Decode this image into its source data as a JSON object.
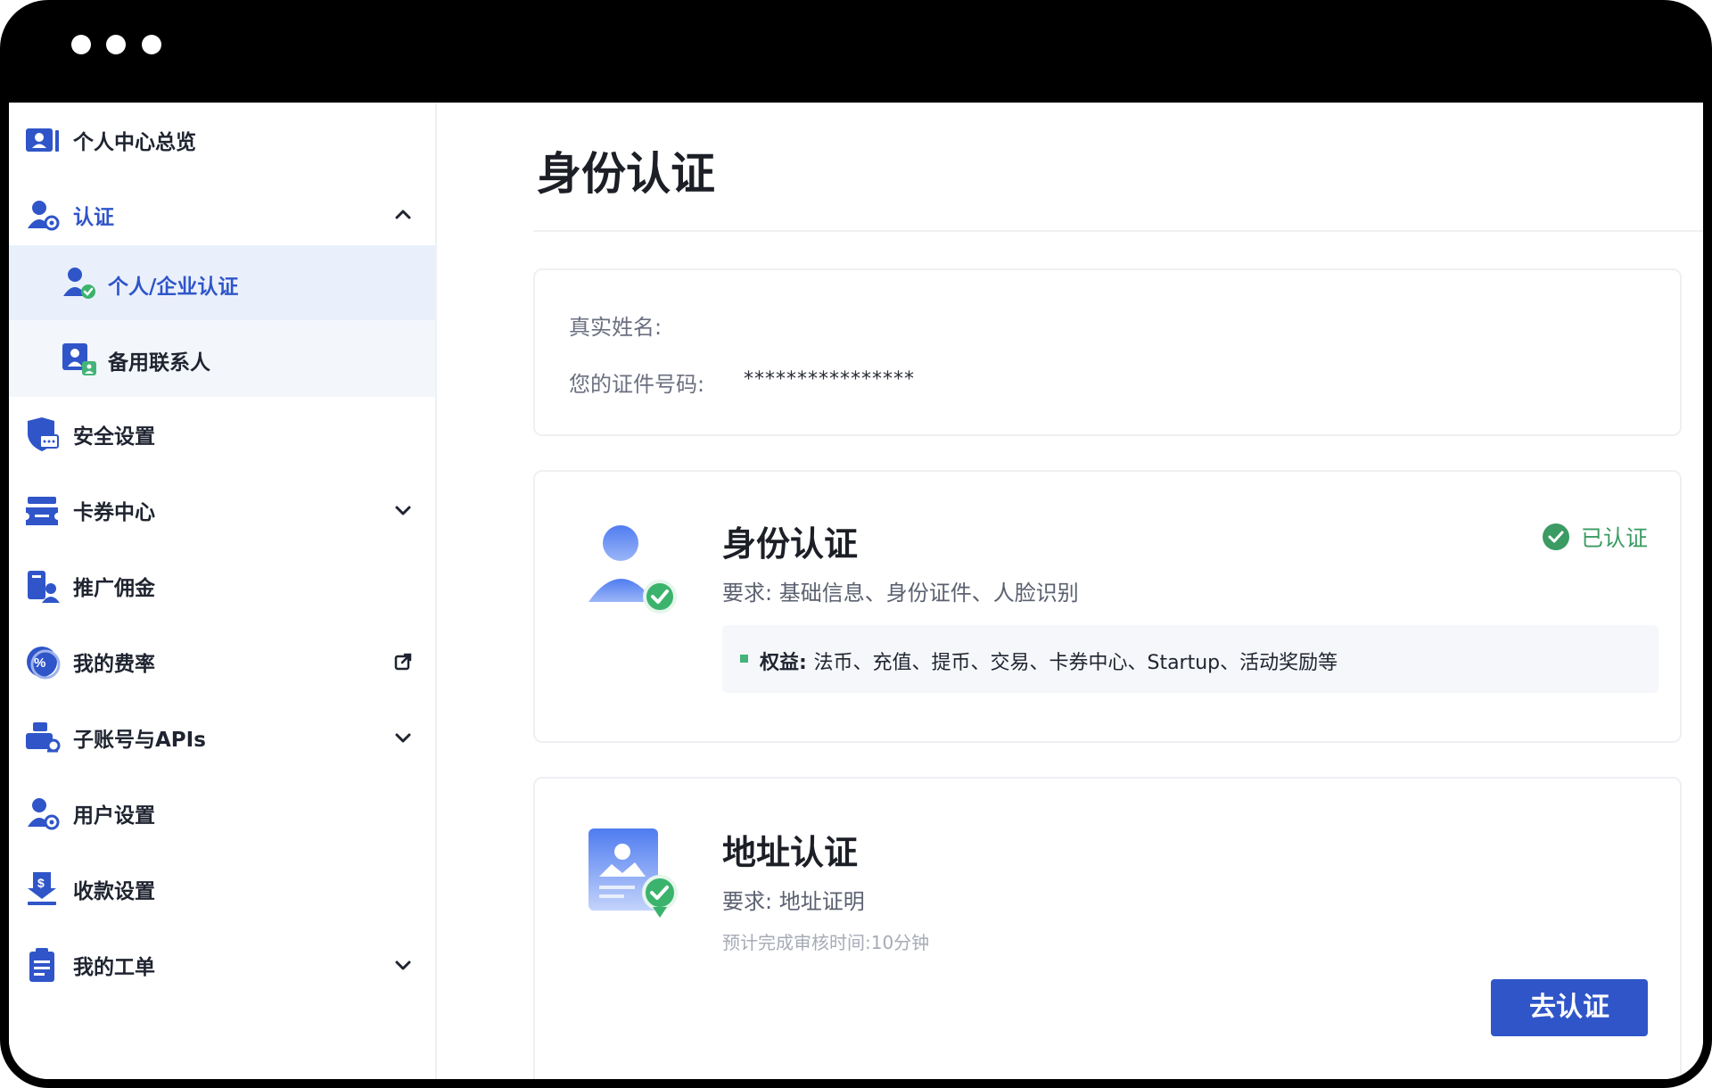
{
  "window": {
    "controls": [
      "dot",
      "dot",
      "dot"
    ]
  },
  "sidebar": {
    "items": [
      {
        "label": "个人中心总览",
        "icon": "profile-card-icon"
      },
      {
        "label": "认证",
        "icon": "user-verified-icon",
        "expanded": true
      },
      {
        "label": "安全设置",
        "icon": "shield-icon"
      },
      {
        "label": "卡券中心",
        "icon": "ticket-icon"
      },
      {
        "label": "推广佣金",
        "icon": "referral-icon"
      },
      {
        "label": "我的费率",
        "icon": "percent-icon"
      },
      {
        "label": "子账号与APIs",
        "icon": "subaccount-key-icon"
      },
      {
        "label": "用户设置",
        "icon": "user-settings-icon"
      },
      {
        "label": "收款设置",
        "icon": "payment-download-icon"
      },
      {
        "label": "我的工单",
        "icon": "ticket-list-icon"
      }
    ],
    "sub_items": [
      {
        "label": "个人/企业认证",
        "selected": true
      },
      {
        "label": "备用联系人",
        "selected": false
      }
    ]
  },
  "main": {
    "title": "身份认证",
    "info": {
      "name_label": "真实姓名:",
      "id_label": "您的证件号码:",
      "id_value": "****************"
    },
    "identity_card": {
      "title": "身份认证",
      "requirement": "要求: 基础信息、身份证件、人脸识别",
      "status": "已认证",
      "benefit_label": "权益:",
      "benefit_text": "法币、充值、提币、交易、卡券中心、Startup、活动奖励等"
    },
    "address_card": {
      "title": "地址认证",
      "requirement": "要求: 地址证明",
      "estimate": "预计完成审核时间:10分钟",
      "button": "去认证"
    }
  },
  "colors": {
    "accent": "#2f55c9",
    "success": "#3b9b63",
    "text": "#1c1f26"
  }
}
